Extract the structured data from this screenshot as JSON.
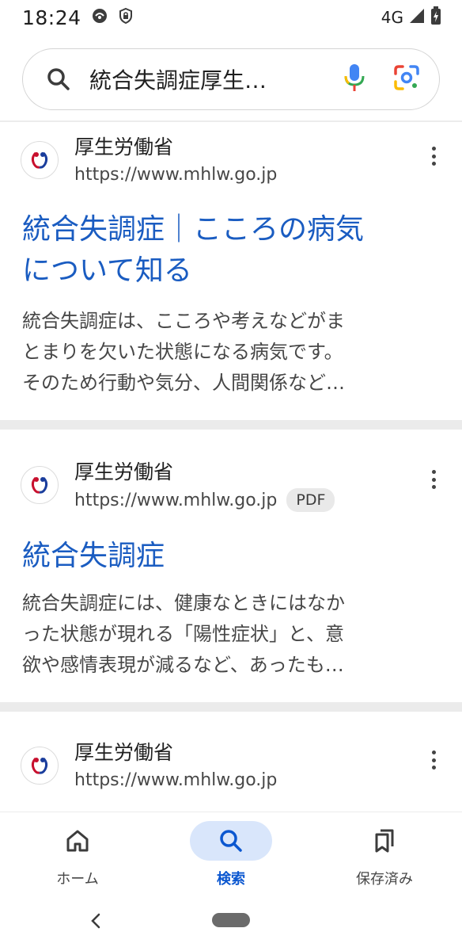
{
  "status_bar": {
    "time": "18:24",
    "network": "4G",
    "icons": [
      "notification-icon",
      "vpn-shield-icon",
      "signal-icon",
      "battery-icon"
    ]
  },
  "search": {
    "query": "統合失調症厚生…",
    "icons": [
      "search-icon",
      "mic-icon",
      "lens-icon"
    ]
  },
  "results": [
    {
      "site_name": "厚生労働省",
      "url": "https://www.mhlw.go.jp",
      "title_line1": "統合失調症｜こころの病気",
      "title_line2": "について知る",
      "snippet_line1": "統合失調症は、こころや考えなどがま",
      "snippet_line2": "とまりを欠いた状態になる病気です。",
      "snippet_line3": "そのため行動や気分、人間関係など…"
    },
    {
      "site_name": "厚生労働省",
      "url": "https://www.mhlw.go.jp",
      "badge": "PDF",
      "title_line1": "統合失調症",
      "snippet_line1": "統合失調症には、健康なときにはなか",
      "snippet_line2": "った状態が現れる「陽性症状」と、意",
      "snippet_line3": "欲や感情表現が減るなど、あったも…"
    },
    {
      "site_name": "厚生労働省",
      "url": "https://www.mhlw.go.jp"
    }
  ],
  "bottom_nav": {
    "home_label": "ホーム",
    "search_label": "検索",
    "saved_label": "保存済み",
    "active": "search"
  },
  "colors": {
    "link_title": "#1a5cc1",
    "active_nav": "#0b57d0",
    "active_nav_bg": "#d9e6fb",
    "separator": "#ebebeb"
  }
}
